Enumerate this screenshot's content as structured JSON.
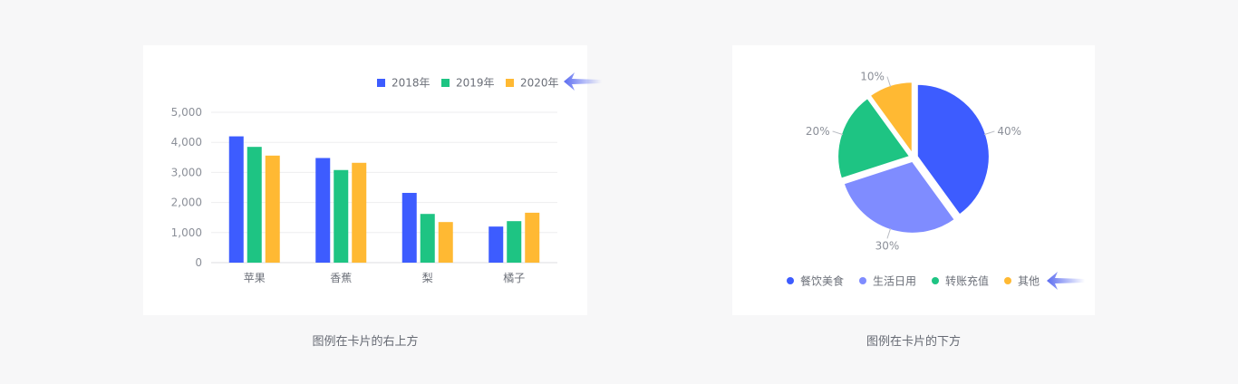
{
  "chart_data": [
    {
      "type": "bar",
      "categories": [
        "苹果",
        "香蕉",
        "梨",
        "橘子"
      ],
      "series": [
        {
          "name": "2018年",
          "values": [
            4200,
            3480,
            2320,
            1200
          ],
          "color": "#3d5cff"
        },
        {
          "name": "2019年",
          "values": [
            3850,
            3080,
            1620,
            1380
          ],
          "color": "#1ec483"
        },
        {
          "name": "2020年",
          "values": [
            3560,
            3320,
            1350,
            1660
          ],
          "color": "#ffb933"
        }
      ],
      "yticks": [
        "0",
        "1,000",
        "2,000",
        "3,000",
        "4,000",
        "5,000"
      ],
      "ylim": [
        0,
        5000
      ],
      "grid": true,
      "legend_position": "top-right"
    },
    {
      "type": "pie",
      "slices": [
        {
          "name": "餐饮美食",
          "value": 40,
          "label": "40%",
          "color": "#3d5cff"
        },
        {
          "name": "生活日用",
          "value": 30,
          "label": "30%",
          "color": "#7f8cff"
        },
        {
          "name": "转账充值",
          "value": 20,
          "label": "20%",
          "color": "#1ec483"
        },
        {
          "name": "其他",
          "value": 10,
          "label": "10%",
          "color": "#ffb933"
        }
      ],
      "legend_position": "bottom"
    }
  ],
  "captions": {
    "bar": "图例在卡片的右上方",
    "pie": "图例在卡片的下方"
  },
  "colors": {
    "arrow": "#5b6cf0",
    "axis_text": "#8c9099",
    "grid": "#eeeeef"
  },
  "icons": {
    "pointer": "arrow-left-icon"
  }
}
